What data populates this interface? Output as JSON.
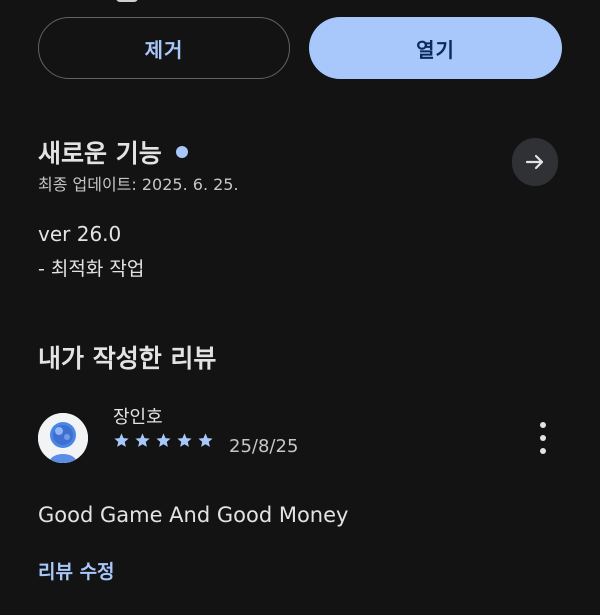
{
  "buttons": {
    "remove_label": "제거",
    "open_label": "열기"
  },
  "whats_new": {
    "title": "새로운 기능",
    "updated": "최종 업데이트: 2025. 6. 25.",
    "version": "ver 26.0",
    "notes": "- 최적화 작업"
  },
  "my_review": {
    "title": "내가 작성한 리뷰",
    "reviewer_name": "장인호",
    "rating": 5,
    "rating_max": 5,
    "date": "25/8/25",
    "text": "Good Game And Good Money",
    "edit_label": "리뷰 수정"
  },
  "colors": {
    "background": "#131314",
    "accent": "#a8c7fa",
    "surface": "#303134",
    "text": "#e3e3e3"
  },
  "icons": [
    "arrow-right-icon",
    "star-icon",
    "more-vert-icon",
    "avatar-icon",
    "new-dot-icon"
  ]
}
